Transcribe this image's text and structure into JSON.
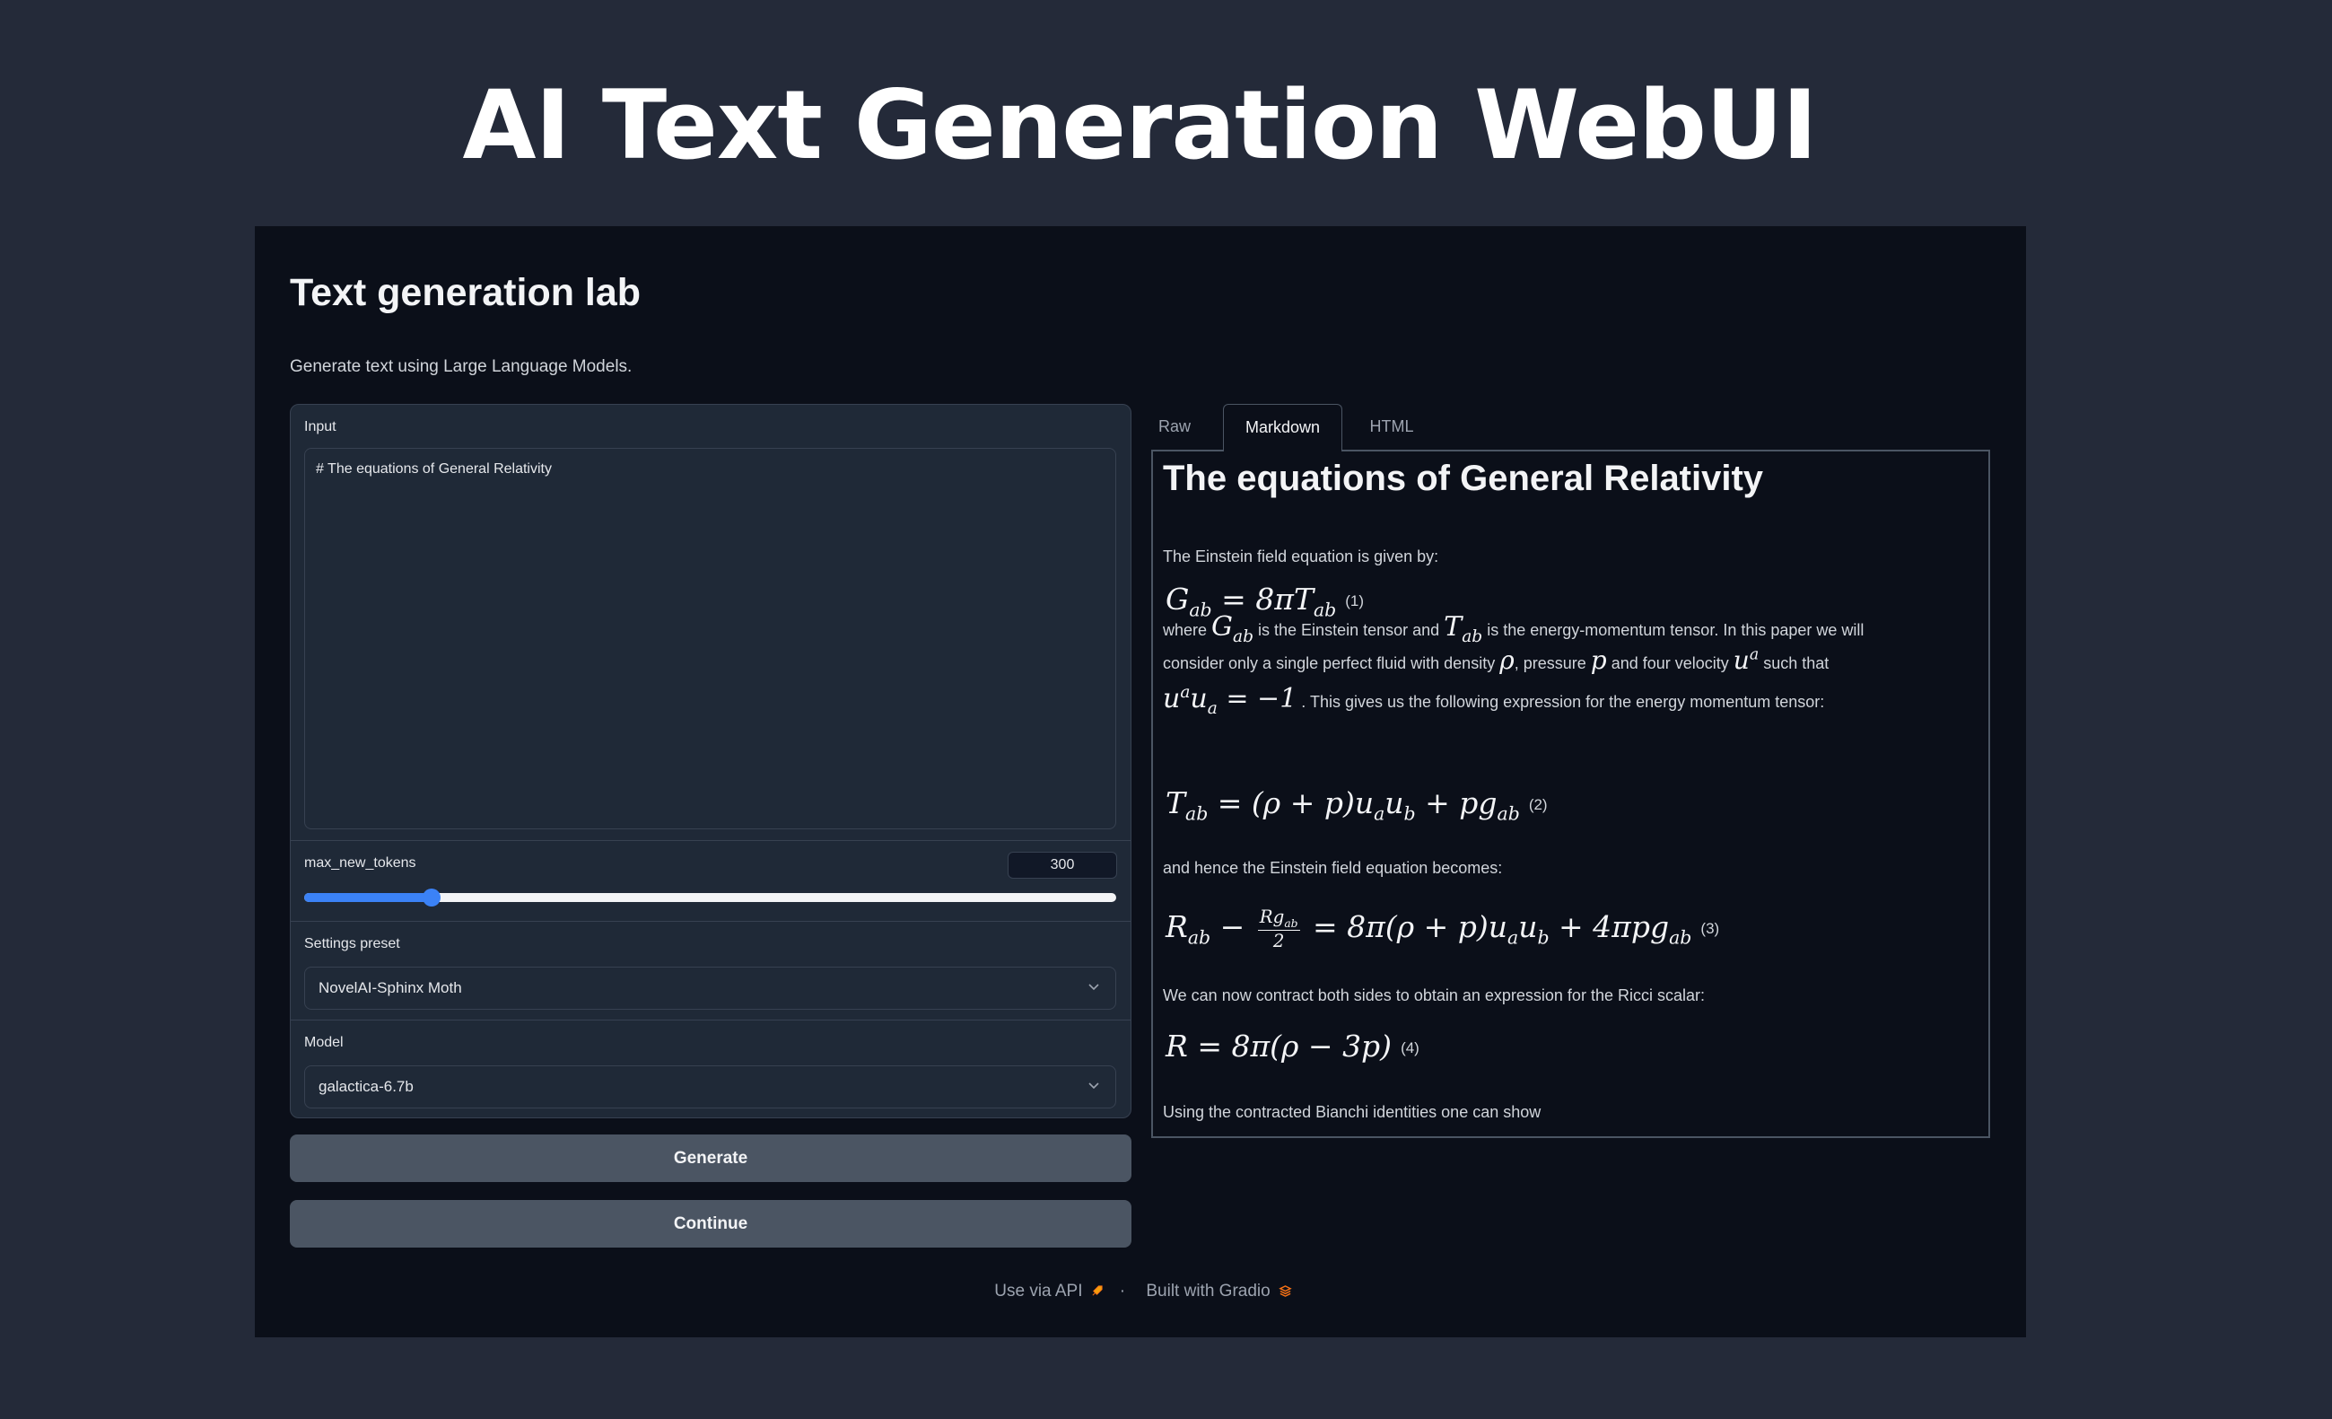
{
  "banner": {
    "title": "AI Text Generation WebUI"
  },
  "app": {
    "title": "Text generation lab",
    "description": "Generate text using Large Language Models."
  },
  "input": {
    "label": "Input",
    "value": "# The equations of General Relativity"
  },
  "max_new_tokens": {
    "label": "max_new_tokens",
    "value": "300",
    "slider_fraction": 0.157
  },
  "settings_preset": {
    "label": "Settings preset",
    "selected": "NovelAI-Sphinx Moth"
  },
  "model": {
    "label": "Model",
    "selected": "galactica-6.7b"
  },
  "buttons": {
    "generate": "Generate",
    "continue": "Continue"
  },
  "tabs": {
    "raw": "Raw",
    "markdown": "Markdown",
    "html": "HTML",
    "active": "Markdown"
  },
  "output": {
    "heading": "The equations of General Relativity",
    "p1": "The Einstein field equation is given by:",
    "eq1_num": "(1)",
    "p2_a": "where",
    "p2_b": "is the Einstein tensor and",
    "p2_c": "is the energy-momentum tensor. In this paper we will",
    "p3_a": "consider only a single perfect fluid with density",
    "p3_b": ", pressure",
    "p3_c": "and four velocity",
    "p3_d": "such that",
    "p4": ". This gives us the following expression for the energy momentum tensor:",
    "eq2_num": "(2)",
    "p5": "and hence the Einstein field equation becomes:",
    "eq3_num": "(3)",
    "p6": "We can now contract both sides to obtain an expression for the Ricci scalar:",
    "eq4_num": "(4)",
    "p7": "Using the contracted Bianchi identities one can show"
  },
  "footer": {
    "api": "Use via API",
    "separator": "·",
    "gradio": "Built with Gradio"
  },
  "colors": {
    "page_bg": "#242a39",
    "app_bg": "#0b0f19",
    "panel_bg": "#1f2937",
    "accent": "#3b82f6",
    "button_bg": "#4b5563"
  }
}
